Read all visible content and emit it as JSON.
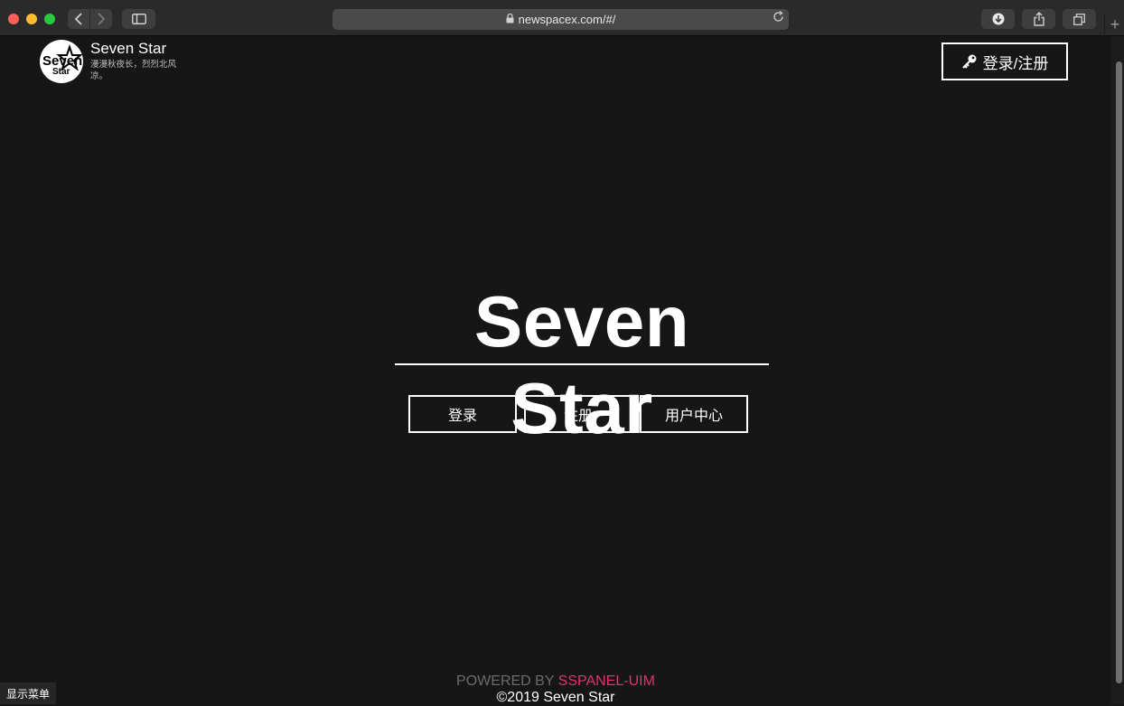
{
  "browser": {
    "url": "newspacex.com/#/",
    "colors": {
      "close": "#fe5f57",
      "minimize": "#febc2e",
      "zoom": "#28c840"
    },
    "icons": [
      "back-icon",
      "forward-icon",
      "sidebar-icon",
      "lock-icon",
      "reload-icon",
      "download-icon",
      "share-icon",
      "tabs-icon",
      "new-tab-icon"
    ]
  },
  "header": {
    "site_name": "Seven Star",
    "slogan": "漫漫秋夜长，烈烈北风凉。",
    "logo_text_top": "Seven",
    "logo_text_bottom": "Star",
    "login_register_label": "登录/注册"
  },
  "hero": {
    "title": "Seven Star",
    "buttons": {
      "login": "登录",
      "register": "注册",
      "user_center": "用户中心"
    }
  },
  "footer": {
    "powered_prefix": "POWERED BY ",
    "powered_brand": "SSPANEL-UIM",
    "brand_color": "#e0336a",
    "copyright": "©2019 Seven Star",
    "show_menu": "显示菜单"
  }
}
